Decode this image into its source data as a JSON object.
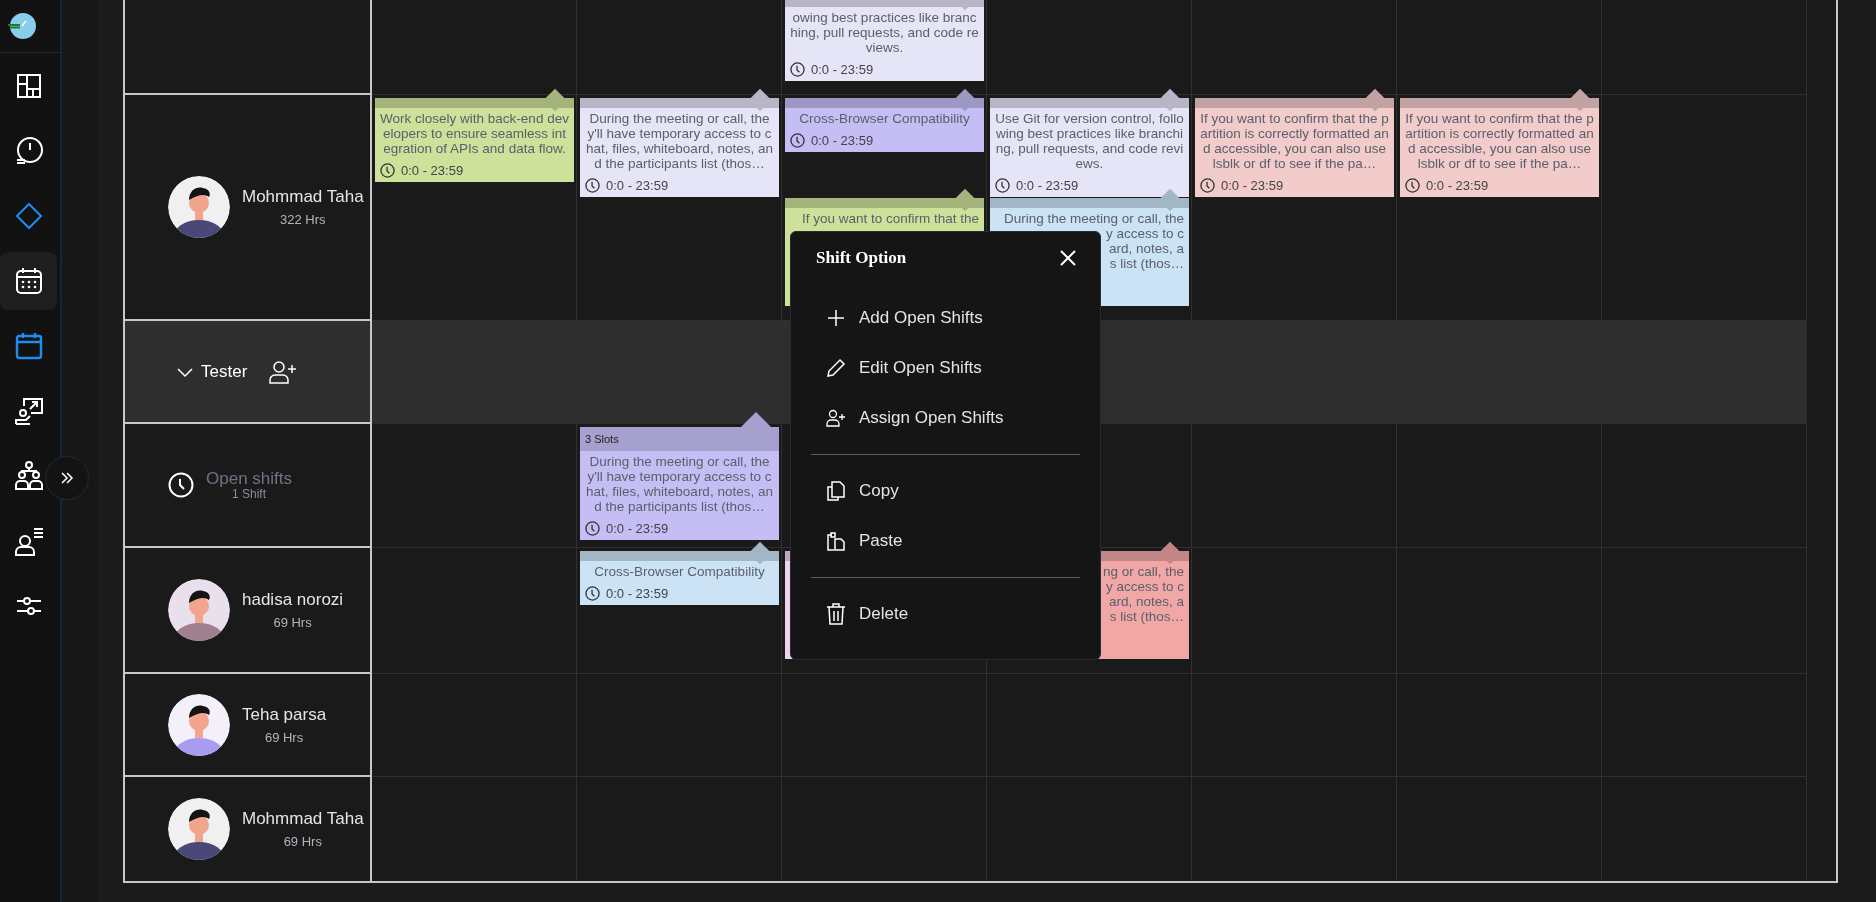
{
  "sidebar": {
    "items": [
      {
        "selected": false,
        "accent": false
      },
      {
        "selected": false,
        "accent": false
      },
      {
        "selected": false,
        "accent": true
      },
      {
        "selected": true,
        "accent": false
      },
      {
        "selected": false,
        "accent": true
      },
      {
        "selected": false,
        "accent": false
      },
      {
        "selected": false,
        "accent": false
      },
      {
        "selected": false,
        "accent": false
      },
      {
        "selected": false,
        "accent": false
      }
    ]
  },
  "schedule": {
    "rows": [
      {
        "kind": "partial",
        "cells": [
          [],
          [],
          [
            {
              "kind": "full",
              "color": "#e6e4f7",
              "text": "owing best practices like branching, pull requests, and code reviews.",
              "time": "0:0 - 23:59"
            }
          ],
          [],
          [],
          [],
          []
        ]
      },
      {
        "kind": "member",
        "name": "Mohmmad Taha",
        "hours": "322 Hrs",
        "cells": [
          [
            {
              "kind": "full",
              "color": "#cde19a",
              "text": "Work closely with back-end developers to ensure seamless integration of APIs and data flow.",
              "time": "0:0 - 23:59"
            }
          ],
          [
            {
              "kind": "full",
              "color": "#e6e4f7",
              "text": "During the meeting or call, they'll have temporary access to chat, files, whiteboard, notes, and the participants list (thos…",
              "time": "0:0 - 23:59"
            }
          ],
          [
            {
              "kind": "full",
              "color": "#c4bef4",
              "text": "Cross-Browser Compatibility",
              "time": "0:0 - 23:59"
            },
            {
              "kind": "covered",
              "color": "#cde19a",
              "lines": [
                "If you want to confirm that the"
              ]
            }
          ],
          [
            {
              "kind": "full",
              "color": "#e6e4f7",
              "text": "Use Git for version control, following best practices like branching, pull requests, and code reviews.",
              "time": "0:0 - 23:59"
            },
            {
              "kind": "covered",
              "color": "#cce3f6",
              "lines": [
                "During the meeting or call, the",
                "y access to c",
                "ard, notes, a",
                "s list (thos…"
              ]
            }
          ],
          [
            {
              "kind": "full",
              "color": "#f2cbcb",
              "text": "If you want to confirm that the partition is correctly formatted and accessible, you can also use lsblk or df to see if the pa…",
              "time": "0:0 - 23:59"
            }
          ],
          [
            {
              "kind": "full",
              "color": "#f2cbcb",
              "text": "If you want to confirm that the partition is correctly formatted and accessible, you can also use lsblk or df to see if the pa…",
              "time": "0:0 - 23:59"
            }
          ],
          []
        ]
      },
      {
        "kind": "group",
        "name": "Tester",
        "expanded": true
      },
      {
        "kind": "open",
        "name": "Open shifts",
        "count": "1 Shift",
        "cells": [
          [],
          [
            {
              "kind": "full",
              "color": "#c4bef4",
              "slots": "3 Slots",
              "text": "During the meeting or call, they'll have temporary access to chat, files, whiteboard, notes, and the participants list (thos…",
              "time": "0:0 - 23:59"
            }
          ],
          [],
          [],
          [],
          [],
          []
        ]
      },
      {
        "kind": "member",
        "name": "hadisa norozi",
        "hours": "69 Hrs",
        "cells": [
          [],
          [
            {
              "kind": "full",
              "color": "#cce3f6",
              "text": "Cross-Browser Compatibility",
              "time": "0:0 - 23:59"
            }
          ],
          [
            {
              "kind": "covered",
              "color": "#ecd3ee"
            }
          ],
          [
            {
              "kind": "covered",
              "color": "#f2a7a7",
              "lines": [
                "ng or call, the",
                "y access to c",
                "ard, notes, a",
                "s list (thos…"
              ]
            }
          ],
          [],
          [],
          []
        ]
      },
      {
        "kind": "member",
        "name": "Teha parsa",
        "hours": "69 Hrs"
      },
      {
        "kind": "member",
        "name": "Mohmmad Taha",
        "hours": "69 Hrs"
      }
    ]
  },
  "shift_menu": {
    "title": "Shift Option",
    "groups": [
      [
        {
          "label": "Add Open Shifts"
        },
        {
          "label": "Edit Open Shifts"
        },
        {
          "label": "Assign Open Shifts"
        }
      ],
      [
        {
          "label": "Copy"
        },
        {
          "label": "Paste"
        }
      ],
      [
        {
          "label": "Delete"
        }
      ]
    ]
  }
}
